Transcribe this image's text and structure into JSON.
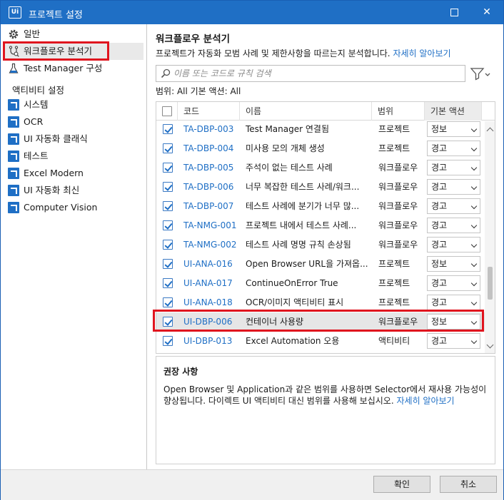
{
  "window": {
    "title": "프로젝트 설정",
    "app_icon_text": "Ui",
    "maximize_icon": "maximize-icon",
    "close_icon": "close-icon",
    "close_glyph": "✕"
  },
  "sidebar": {
    "items": [
      {
        "label": "일반",
        "icon": "gear-icon"
      },
      {
        "label": "워크플로우 분석기",
        "icon": "workflow-analyzer-icon",
        "active": true
      },
      {
        "label": "Test Manager 구성",
        "icon": "flask-icon"
      }
    ],
    "section_label": "액티비티 설정",
    "activity_items": [
      {
        "label": "시스템",
        "icon": "activity-package-icon"
      },
      {
        "label": "OCR",
        "icon": "activity-package-icon"
      },
      {
        "label": "UI 자동화 클래식",
        "icon": "activity-package-icon"
      },
      {
        "label": "테스트",
        "icon": "activity-package-icon"
      },
      {
        "label": "Excel Modern",
        "icon": "activity-package-icon"
      },
      {
        "label": "UI 자동화 최신",
        "icon": "activity-package-icon"
      },
      {
        "label": "Computer Vision",
        "icon": "activity-package-icon"
      }
    ]
  },
  "main": {
    "title": "워크플로우 분석기",
    "description": "프로젝트가 자동화 모범 사례 및 제한사항을 따르는지 분석합니다.",
    "learn_more": "자세히 알아보기",
    "search_placeholder": "이름 또는 코드로 규칙 검색",
    "filter_summary": "범위: All   기본 액션: All",
    "columns": {
      "code": "코드",
      "name": "이름",
      "scope": "범위",
      "default_action": "기본 액션"
    },
    "rules": [
      {
        "code": "TA-DBP-003",
        "name": "Test Manager 연결됨",
        "scope": "프로젝트",
        "action": "정보",
        "checked": true
      },
      {
        "code": "TA-DBP-004",
        "name": "미사용 모의 개체 생성",
        "scope": "프로젝트",
        "action": "경고",
        "checked": true
      },
      {
        "code": "TA-DBP-005",
        "name": "주석이 없는 테스트 사례",
        "scope": "워크플로우",
        "action": "경고",
        "checked": true
      },
      {
        "code": "TA-DBP-006",
        "name": "너무 복잡한 테스트 사례/워크...",
        "scope": "워크플로우",
        "action": "경고",
        "checked": true
      },
      {
        "code": "TA-DBP-007",
        "name": "테스트 사례에 분기가 너무 많...",
        "scope": "워크플로우",
        "action": "경고",
        "checked": true
      },
      {
        "code": "TA-NMG-001",
        "name": "프로젝트 내에서 테스트 사례...",
        "scope": "워크플로우",
        "action": "경고",
        "checked": true
      },
      {
        "code": "TA-NMG-002",
        "name": "테스트 사례 명명 규칙 손상됨",
        "scope": "워크플로우",
        "action": "경고",
        "checked": true
      },
      {
        "code": "UI-ANA-016",
        "name": "Open Browser URL을 가져옵...",
        "scope": "프로젝트",
        "action": "정보",
        "checked": true
      },
      {
        "code": "UI-ANA-017",
        "name": "ContinueOnError True",
        "scope": "프로젝트",
        "action": "경고",
        "checked": true
      },
      {
        "code": "UI-ANA-018",
        "name": "OCR/이미지 액티비티 표시",
        "scope": "프로젝트",
        "action": "경고",
        "checked": true
      },
      {
        "code": "UI-DBP-006",
        "name": "컨테이너 사용량",
        "scope": "워크플로우",
        "action": "정보",
        "checked": true,
        "selected": true
      },
      {
        "code": "UI-DBP-013",
        "name": "Excel Automation 오용",
        "scope": "액티비티",
        "action": "경고",
        "checked": true
      }
    ],
    "recommendation": {
      "title": "권장 사항",
      "text": "Open Browser 및 Application과 같은 범위를 사용하면 Selector에서 재사용 가능성이 향상됩니다. 다이렉트 UI 액티비티 대신 범위를 사용해 보십시오.",
      "link": "자세히 알아보기"
    }
  },
  "footer": {
    "ok": "확인",
    "cancel": "취소"
  }
}
